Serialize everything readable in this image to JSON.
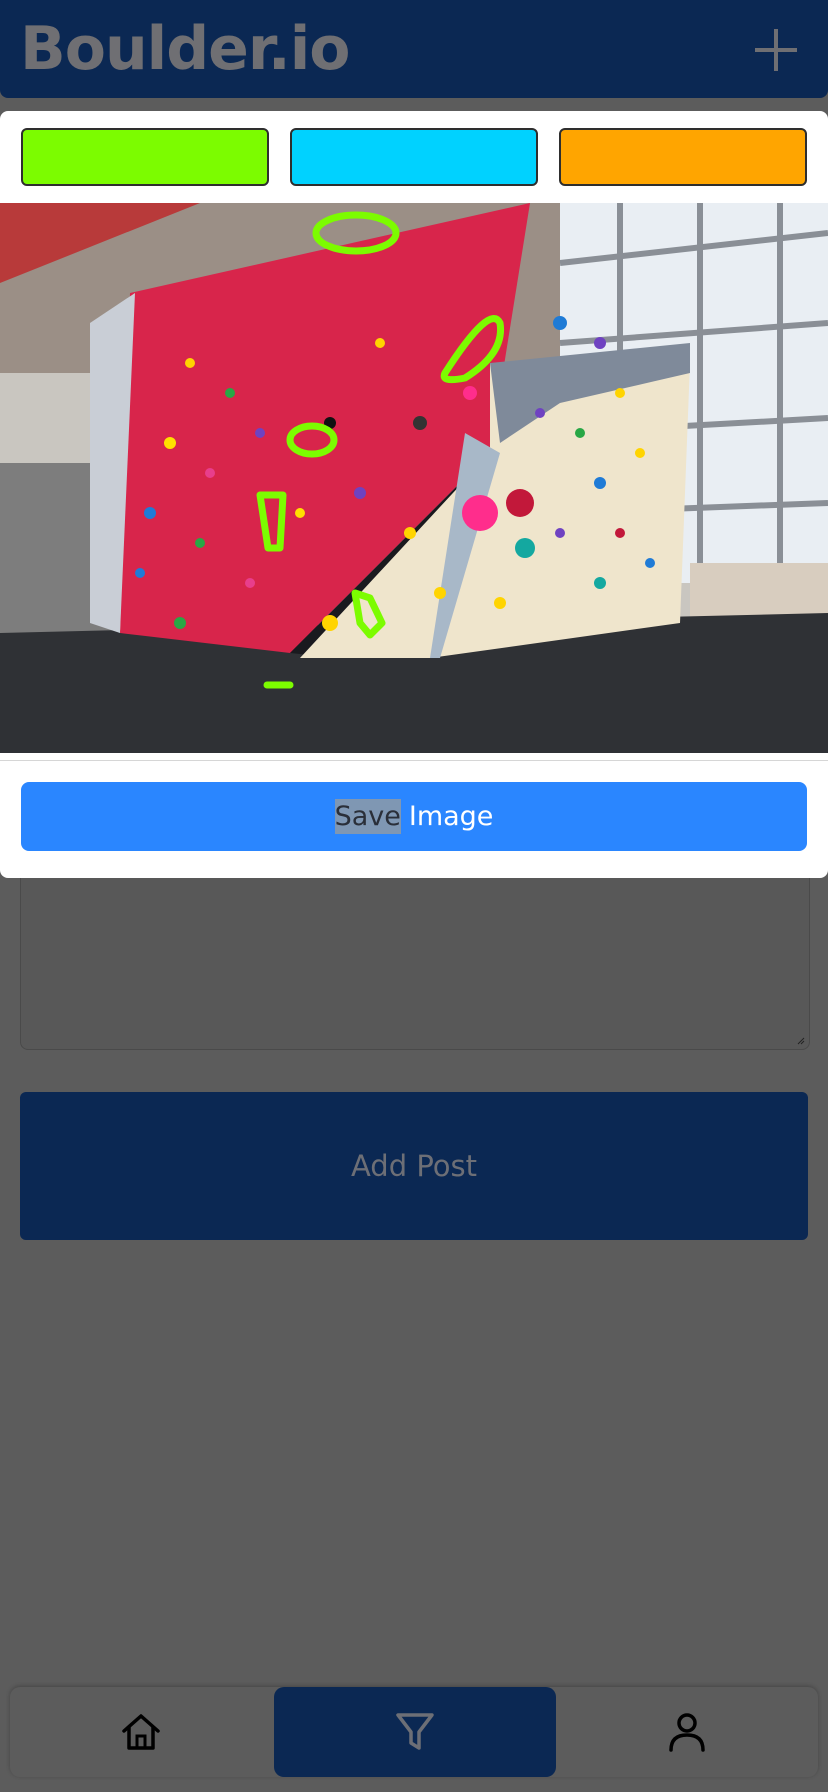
{
  "header": {
    "app_title": "Boulder.io",
    "add_icon": "plus-icon"
  },
  "modal": {
    "color_options": [
      {
        "name": "green",
        "color": "#7cfc00"
      },
      {
        "name": "cyan",
        "color": "#00d2ff"
      },
      {
        "name": "orange",
        "color": "#ffa500"
      }
    ],
    "save_button": {
      "highlight_text": "Save",
      "rest_text": "Image"
    }
  },
  "form": {
    "add_post_label": "Add Post"
  },
  "bottom_nav": {
    "items": [
      {
        "icon": "home-icon",
        "active": false
      },
      {
        "icon": "filter-icon",
        "active": true
      },
      {
        "icon": "user-icon",
        "active": false
      }
    ]
  },
  "colors": {
    "header_bg": "#0b2853",
    "primary_button": "#2a86ff",
    "overlay_bg": "#5c5c5c"
  }
}
